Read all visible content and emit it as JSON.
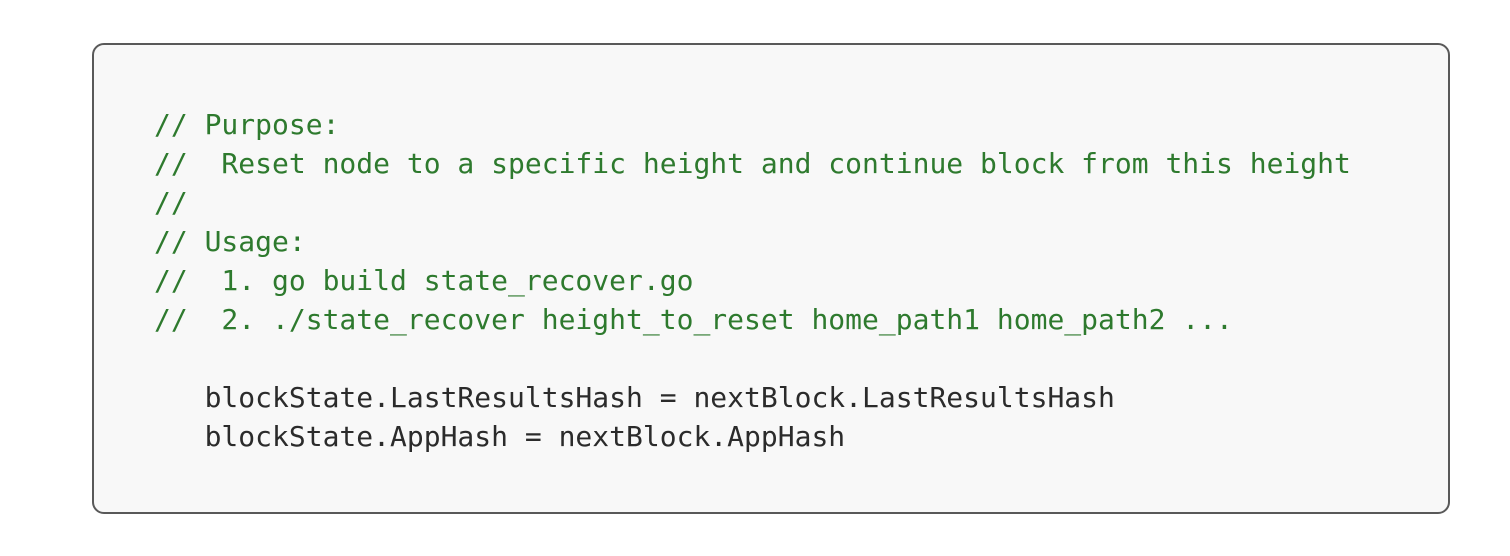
{
  "page": {
    "background_color": "#ffffff"
  },
  "code_block": {
    "name": "code-snippet-card",
    "background_color": "#f8f8f8",
    "border_color": "#595959",
    "comment_color": "#2e7a2e",
    "code_color": "#2b2b2b",
    "language": "go",
    "lines": [
      {
        "text": "// Purpose:",
        "kind": "comment"
      },
      {
        "text": "//  Reset node to a specific height and continue block from this height",
        "kind": "comment"
      },
      {
        "text": "//",
        "kind": "comment"
      },
      {
        "text": "// Usage:",
        "kind": "comment"
      },
      {
        "text": "//  1. go build state_recover.go",
        "kind": "comment"
      },
      {
        "text": "//  2. ./state_recover height_to_reset home_path1 home_path2 ...",
        "kind": "comment"
      },
      {
        "text": "",
        "kind": "blank"
      },
      {
        "text": "   blockState.LastResultsHash = nextBlock.LastResultsHash",
        "kind": "code"
      },
      {
        "text": "   blockState.AppHash = nextBlock.AppHash",
        "kind": "code"
      }
    ]
  }
}
